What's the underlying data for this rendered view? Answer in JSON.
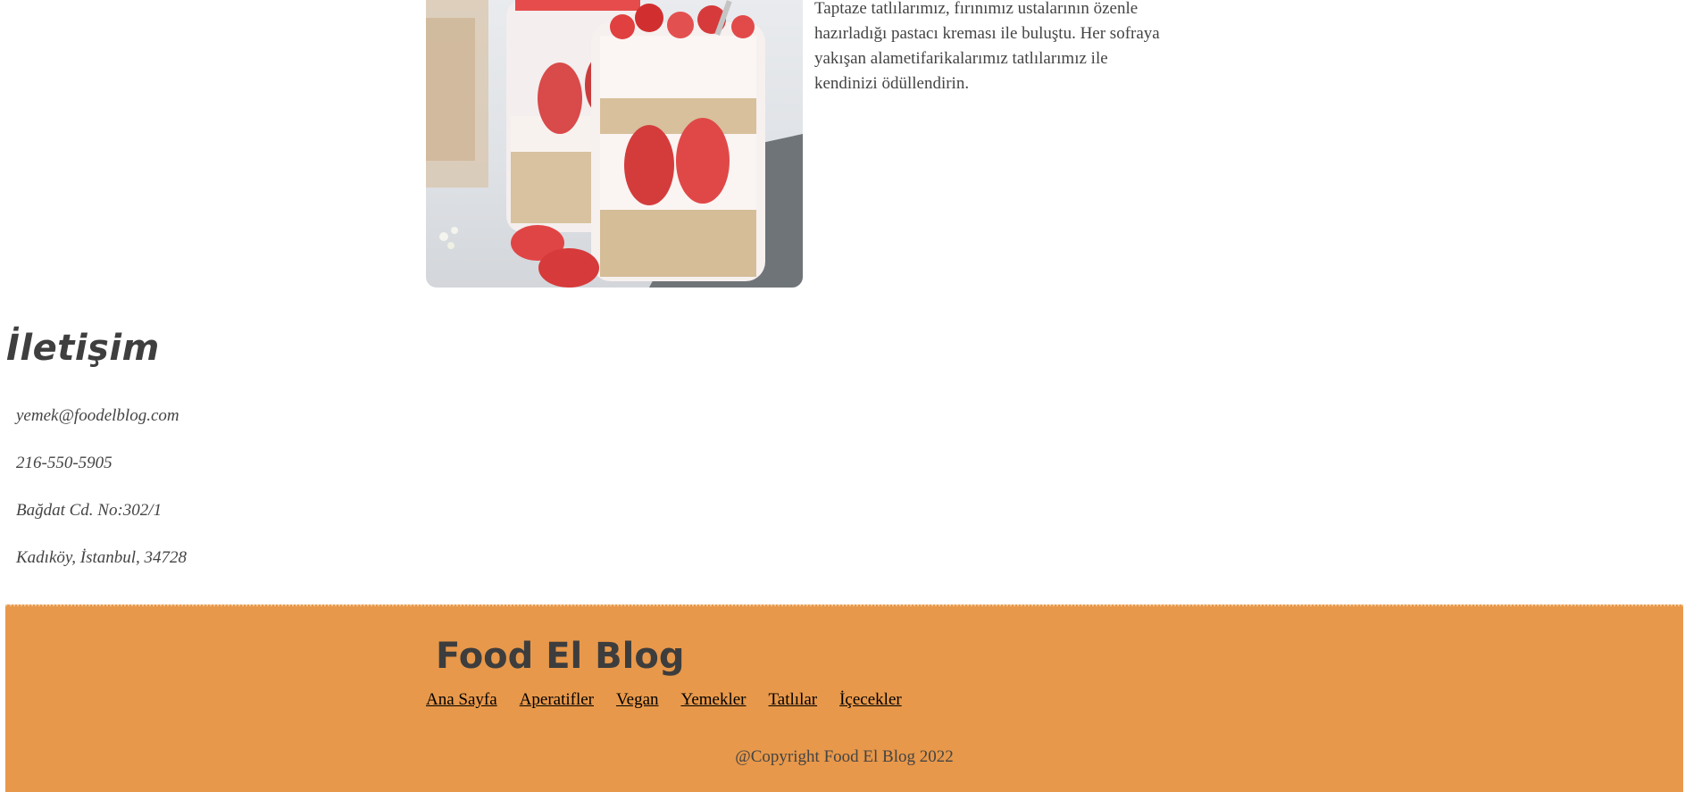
{
  "dessert": {
    "image_alt": "strawberry yogurt parfait jars",
    "description": "Taptaze tatlılarımız, fırınımız ustalarının özenle hazırladığı pastacı kreması ile buluştu. Her sofraya yakışan alametifarikalarımız tatlılarımız ile kendinizi ödüllendirin."
  },
  "contact": {
    "title": "İletişim",
    "items": [
      "yemek@foodelblog.com",
      "216-550-5905",
      "Bağdat Cd. No:302/1",
      "Kadıköy, İstanbul, 34728"
    ]
  },
  "footer": {
    "title": "Food El Blog",
    "nav": [
      "Ana Sayfa",
      "Aperatifler",
      "Vegan",
      "Yemekler",
      "Tatlılar",
      "İçecekler"
    ],
    "copyright": "@Copyright Food El Blog 2022"
  },
  "colors": {
    "footer_bg": "#e8984a",
    "text": "#444444",
    "link": "#000000"
  }
}
